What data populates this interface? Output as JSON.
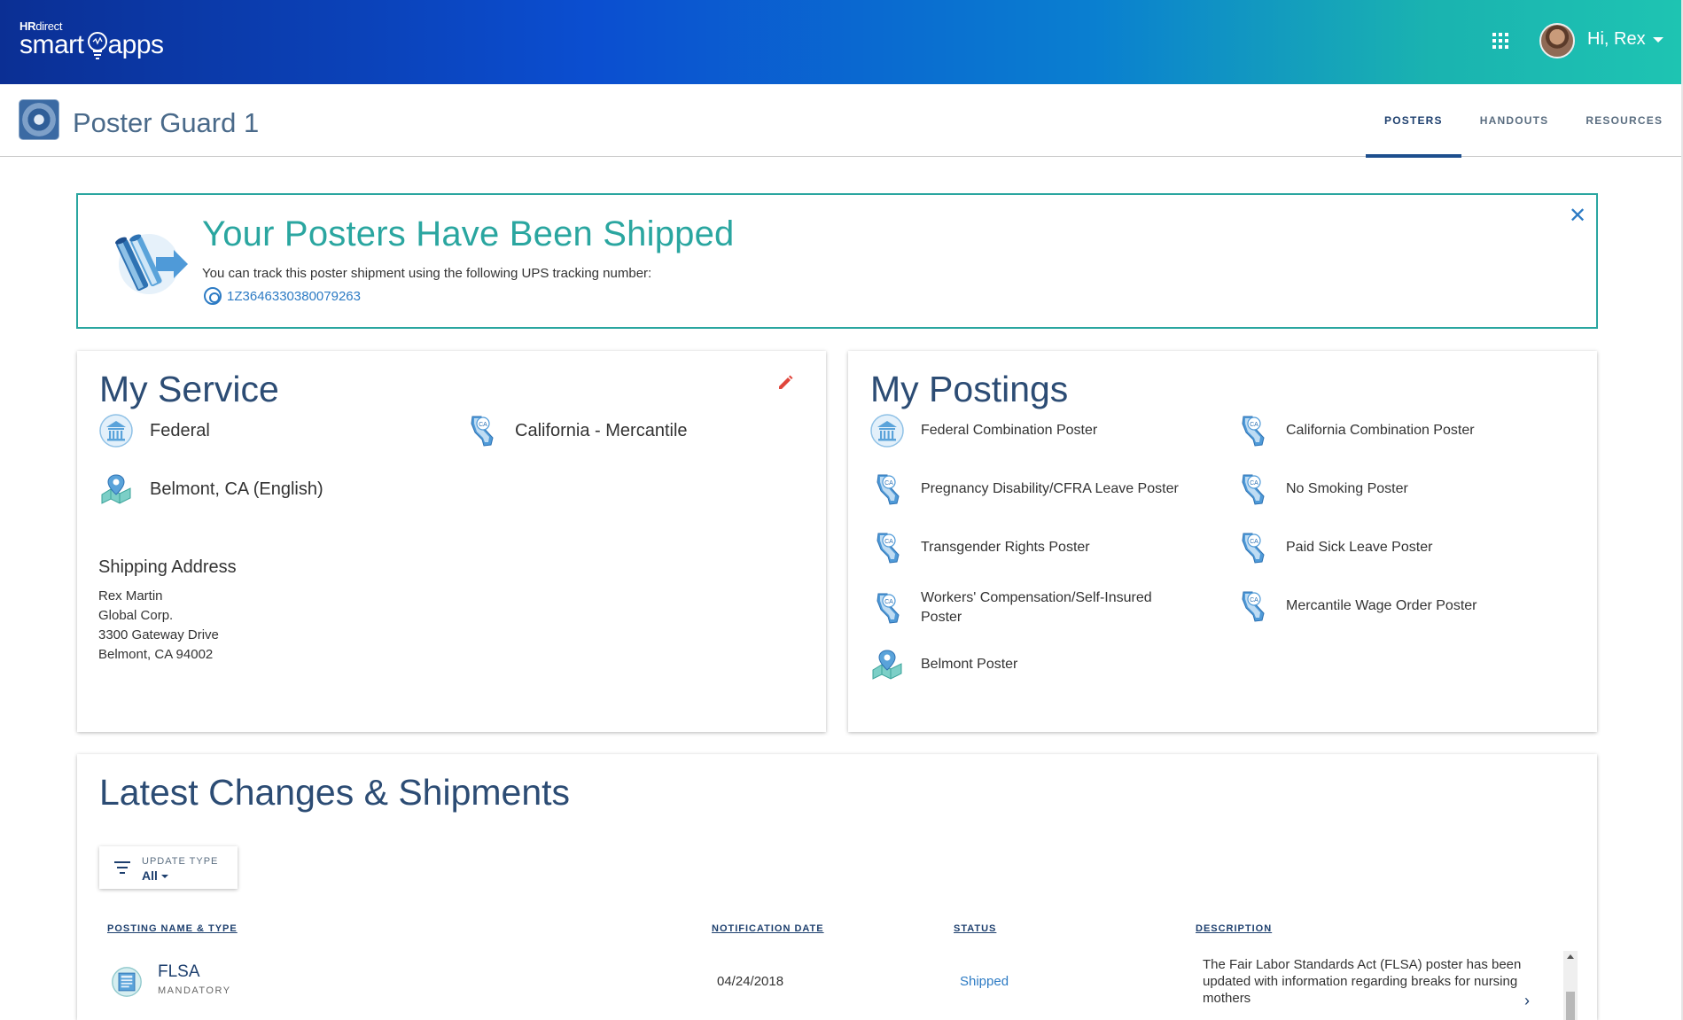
{
  "header": {
    "logo_hr": "HR",
    "logo_direct": "direct",
    "logo_smart": "smart",
    "logo_apps": "apps",
    "greeting": "Hi, Rex"
  },
  "subheader": {
    "app_title": "Poster Guard 1",
    "tabs": [
      {
        "label": "POSTERS",
        "active": true
      },
      {
        "label": "HANDOUTS",
        "active": false
      },
      {
        "label": "RESOURCES",
        "active": false
      }
    ]
  },
  "alert": {
    "title": "Your Posters Have Been Shipped",
    "text": "You can track this poster shipment using the following UPS tracking number:",
    "tracking_number": "1Z3646330380079263"
  },
  "service": {
    "title": "My Service",
    "items": [
      {
        "label": "Federal",
        "icon": "federal-building-icon"
      },
      {
        "label": "California - Mercantile",
        "icon": "california-state-icon"
      },
      {
        "label": "Belmont, CA (English)",
        "icon": "city-map-pin-icon"
      }
    ],
    "shipping_label": "Shipping Address",
    "address": [
      "Rex Martin",
      "Global Corp.",
      "3300 Gateway Drive",
      "Belmont, CA 94002"
    ]
  },
  "postings": {
    "title": "My Postings",
    "items": [
      {
        "label": "Federal Combination Poster",
        "icon": "federal-building-icon"
      },
      {
        "label": "California Combination Poster",
        "icon": "california-state-icon"
      },
      {
        "label": "Pregnancy Disability/CFRA Leave Poster",
        "icon": "california-state-icon"
      },
      {
        "label": "No Smoking Poster",
        "icon": "california-state-icon"
      },
      {
        "label": "Transgender Rights Poster",
        "icon": "california-state-icon"
      },
      {
        "label": "Paid Sick Leave Poster",
        "icon": "california-state-icon"
      },
      {
        "label": "Workers' Compensation/Self-Insured Poster",
        "icon": "california-state-icon"
      },
      {
        "label": "Mercantile Wage Order Poster",
        "icon": "california-state-icon"
      },
      {
        "label": "Belmont Poster",
        "icon": "city-map-pin-icon"
      }
    ]
  },
  "changes": {
    "title": "Latest Changes & Shipments",
    "filter_label": "UPDATE TYPE",
    "filter_value": "All",
    "columns": [
      "POSTING NAME & TYPE",
      "NOTIFICATION DATE",
      "STATUS",
      "DESCRIPTION"
    ],
    "rows": [
      {
        "name": "FLSA",
        "type": "MANDATORY",
        "date": "04/24/2018",
        "status": "Shipped",
        "description": "The Fair Labor Standards Act (FLSA) poster has been updated with information regarding breaks for nursing mothers"
      }
    ]
  },
  "colors": {
    "teal_accent": "#2aa6a0",
    "navy_text": "#1d3f6e",
    "link_blue": "#2d7bc4",
    "edit_red": "#e0463c"
  }
}
